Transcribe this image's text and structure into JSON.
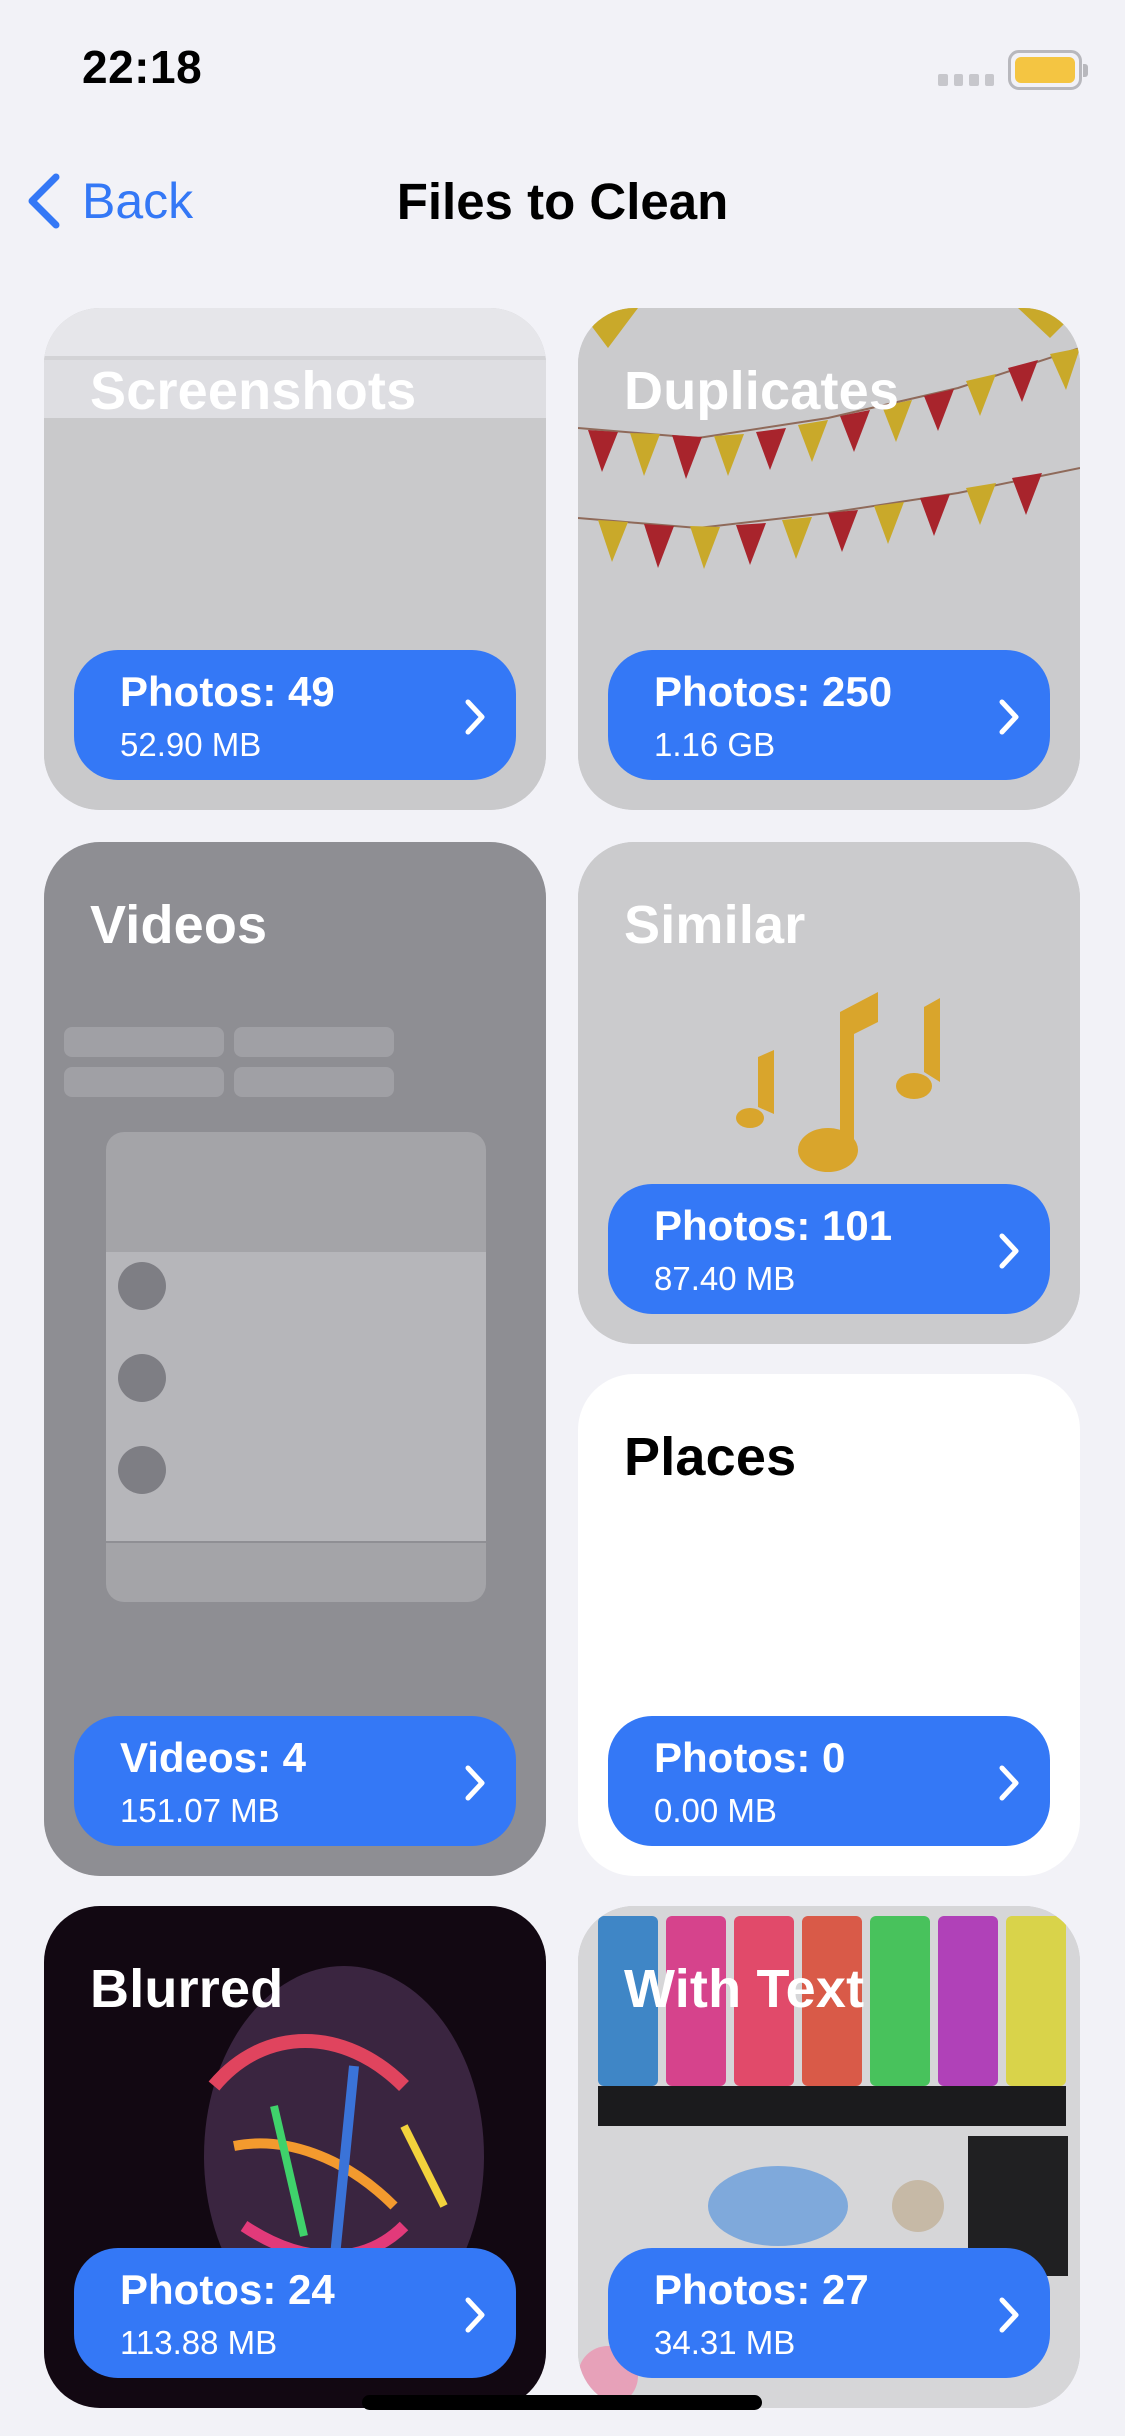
{
  "status_bar": {
    "time": "22:18"
  },
  "nav": {
    "back_label": "Back",
    "title": "Files to Clean"
  },
  "tiles": {
    "screenshots": {
      "title": "Screenshots",
      "count": "Photos: 49",
      "size": "52.90 MB"
    },
    "duplicates": {
      "title": "Duplicates",
      "count": "Photos: 250",
      "size": "1.16 GB"
    },
    "videos": {
      "title": "Videos",
      "count": "Videos: 4",
      "size": "151.07 MB"
    },
    "similar": {
      "title": "Similar",
      "count": "Photos: 101",
      "size": "87.40 MB"
    },
    "places": {
      "title": "Places",
      "count": "Photos: 0",
      "size": "0.00 MB"
    },
    "blurred": {
      "title": "Blurred",
      "count": "Photos: 24",
      "size": "113.88 MB"
    },
    "with_text": {
      "title": "With Text",
      "count": "Photos: 27",
      "size": "34.31 MB"
    }
  },
  "icons": {
    "back": "chevron-left-icon",
    "open": "chevron-right-icon"
  },
  "colors": {
    "accent": "#3478f6",
    "background": "#f2f2f7",
    "battery": "#f4c542",
    "tile_dim": "#c9c9cb"
  }
}
